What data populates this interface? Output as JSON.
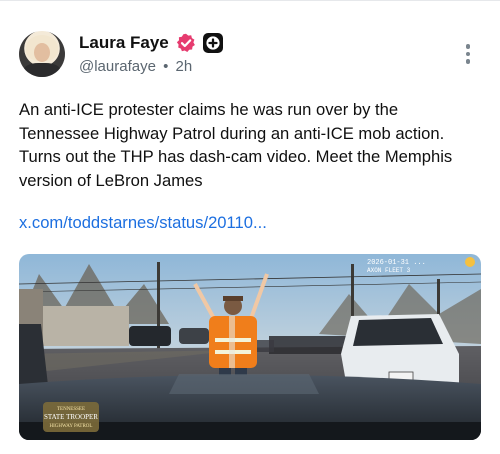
{
  "author": {
    "name": "Laura Faye",
    "handle": "@laurafaye",
    "time": "2h",
    "separator": "•"
  },
  "post": {
    "text": "An anti-ICE protester claims he was run over by the Tennessee Highway Patrol during an anti-ICE mob action. Turns out the THP has dash-cam video. Meet the Memphis version of LeBron James",
    "link": "x.com/toddstarnes/status/20110..."
  },
  "media": {
    "overlay_line1": "2026-01-31 ...",
    "overlay_line2": "STATE TROOPER",
    "overlay_line3": "TENNESSEE",
    "overlay_line4": "HIGHWAY PATROL"
  },
  "colors": {
    "link": "#1d6fe0",
    "verified_badge": "#e63b6f",
    "secondary_text": "#5b6670"
  },
  "icons": {
    "verified": "verified-badge-icon",
    "plus": "plus-badge-icon",
    "more": "more-vertical-icon"
  }
}
